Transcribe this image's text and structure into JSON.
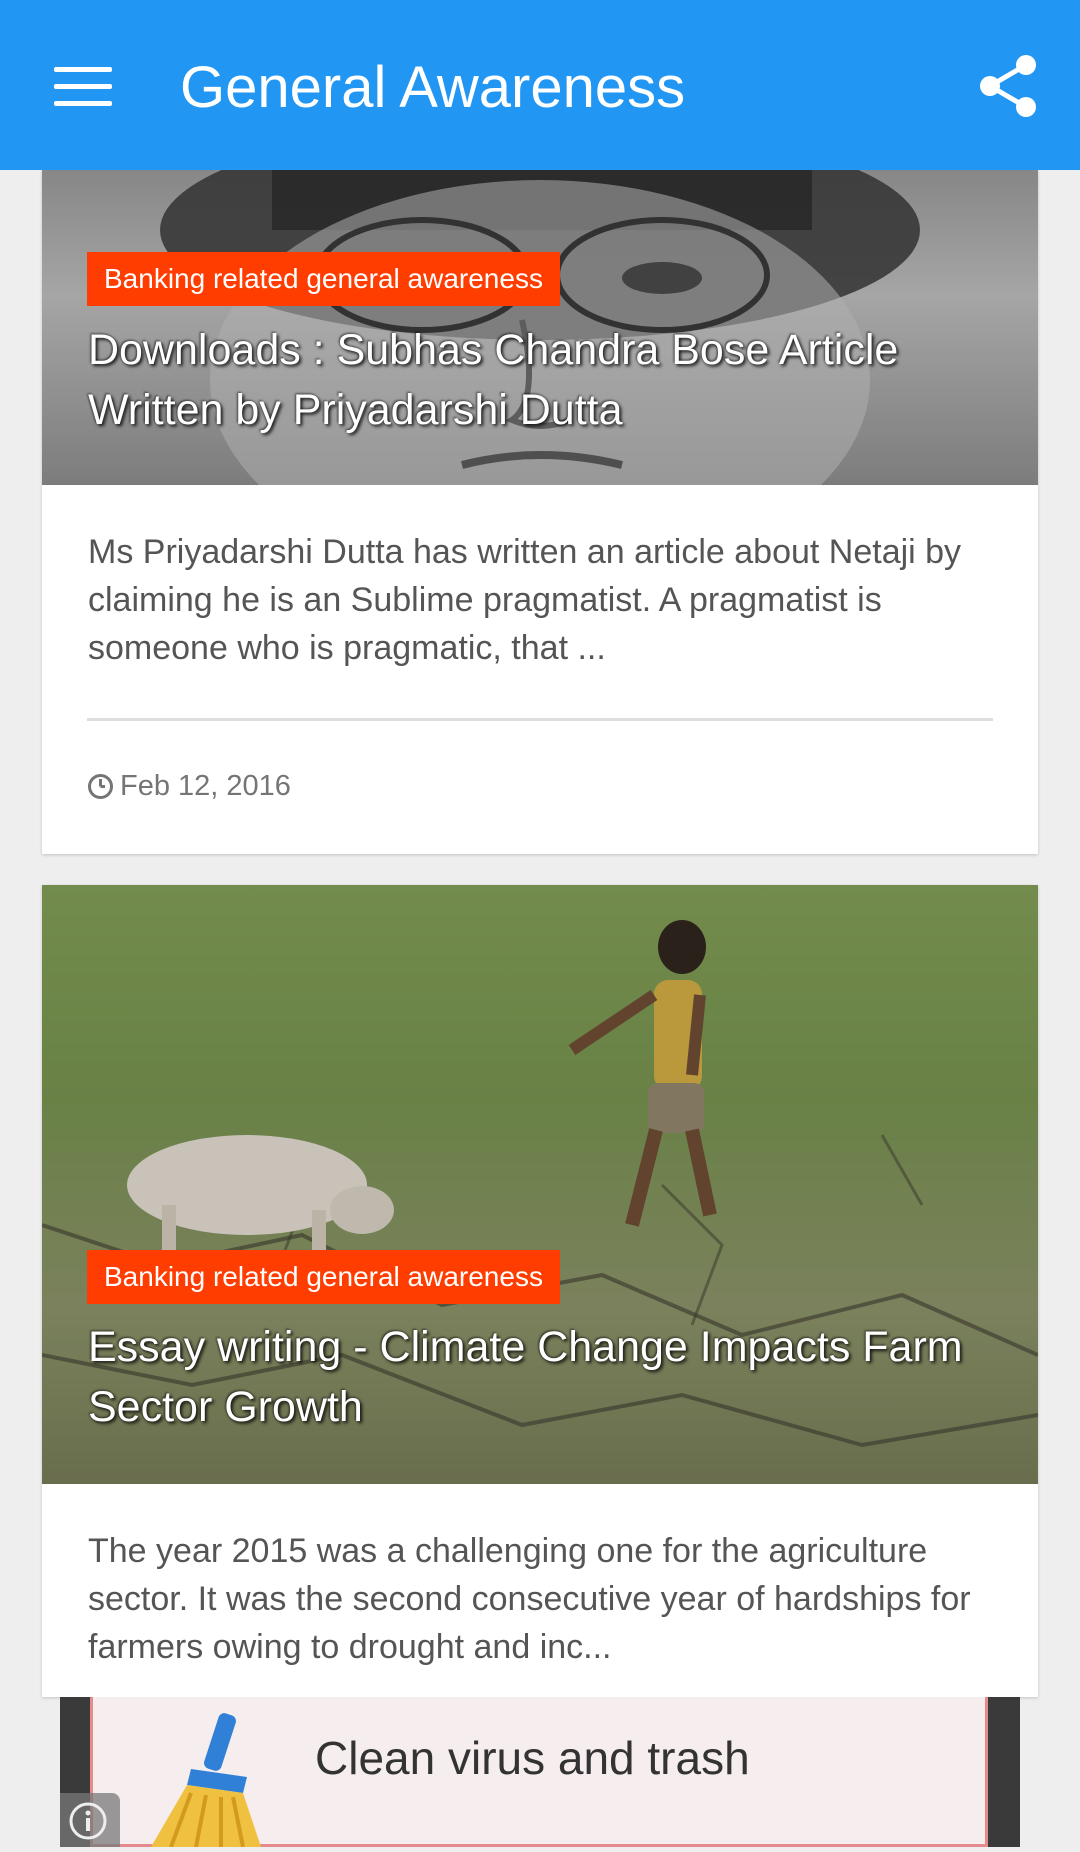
{
  "app_bar": {
    "title": "General Awareness",
    "icons": [
      "menu-icon",
      "share-icon"
    ],
    "background_color": "#2196f3"
  },
  "posts": [
    {
      "category": "Banking related general awareness",
      "title": "Downloads : Subhas Chandra Bose Article Written by Priyadarshi Dutta",
      "excerpt": "Ms Priyadarshi Dutta has written an article about Netaji by claiming he is an Sublime pragmatist. A pragmatist is someone who is pragmatic, that ...",
      "date": "Feb 12, 2016",
      "image": "portrait-photo"
    },
    {
      "category": "Banking related general awareness",
      "title": "Essay writing - Climate Change Impacts Farm Sector Growth",
      "excerpt": "The year 2015 was a challenging one for the agriculture sector. It was the second consecutive year of hardships for farmers owing to drought and inc...",
      "image": "dry-field-photo"
    }
  ],
  "ad": {
    "text": "Clean virus and trash",
    "icons": [
      "broom-icon",
      "info-icon"
    ]
  },
  "colors": {
    "category_badge": "#ff3d00",
    "page_background": "#eeeeee"
  }
}
